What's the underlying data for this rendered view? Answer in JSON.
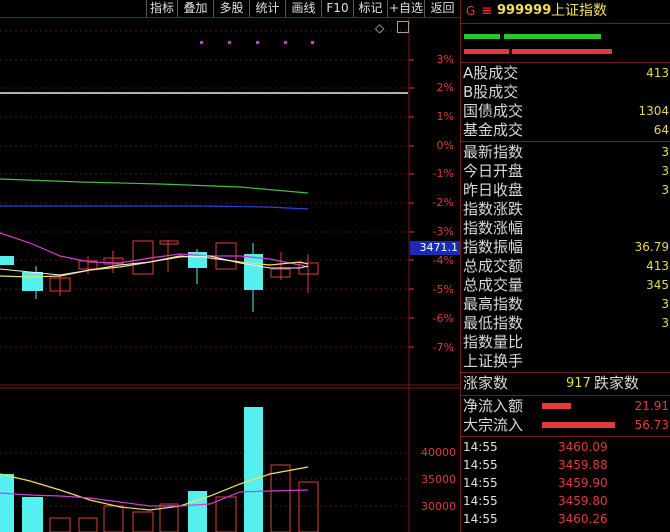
{
  "toolbar": {
    "buttons": [
      "指标",
      "叠加",
      "多股",
      "统计",
      "画线",
      "F10",
      "标记",
      "+自选",
      "返回"
    ]
  },
  "chart": {
    "pct_labels": [
      "3%",
      "2%",
      "1%",
      "0%",
      "-1%",
      "-2%",
      "-3%",
      "-4%",
      "-5%",
      "-6%",
      "-7%"
    ],
    "price_tag": "3471.1",
    "volume_labels": [
      "40000",
      "35000",
      "30000"
    ],
    "collapse_icon": "◇"
  },
  "panel": {
    "badge": "G",
    "menu_icon": "≡",
    "code": "999999",
    "name": "上证指数",
    "rows": [
      {
        "label": "A股成交",
        "value": "413"
      },
      {
        "label": "B股成交",
        "value": ""
      },
      {
        "label": "国债成交",
        "value": "1304"
      },
      {
        "label": "基金成交",
        "value": "64"
      },
      {
        "label": "最新指数",
        "value": "3"
      },
      {
        "label": "今日开盘",
        "value": "3"
      },
      {
        "label": "昨日收盘",
        "value": "3"
      },
      {
        "label": "指数涨跌",
        "value": ""
      },
      {
        "label": "指数涨幅",
        "value": ""
      },
      {
        "label": "指数振幅",
        "value": "36.79"
      },
      {
        "label": "总成交额",
        "value": "413"
      },
      {
        "label": "总成交量",
        "value": "345"
      },
      {
        "label": "最高指数",
        "value": "3"
      },
      {
        "label": "最低指数",
        "value": "3"
      },
      {
        "label": "指数量比",
        "value": ""
      },
      {
        "label": "上证换手",
        "value": ""
      }
    ],
    "rise_label": "涨家数",
    "rise_count": "917",
    "fall_label": "跌家数",
    "flows": [
      {
        "label": "净流入额",
        "value": "21.91"
      },
      {
        "label": "大宗流入",
        "value": "56.73"
      }
    ],
    "ticks": [
      {
        "time": "14:55",
        "price": "3460.09"
      },
      {
        "time": "14:55",
        "price": "3459.88"
      },
      {
        "time": "14:55",
        "price": "3459.90"
      },
      {
        "time": "14:55",
        "price": "3459.80"
      },
      {
        "time": "14:55",
        "price": "3460.26"
      }
    ]
  },
  "colors": {
    "up": "#e23b3b",
    "down": "#54f0f0",
    "ma_yellow": "#f0e060",
    "ma_magenta": "#d040d0",
    "ma_green": "#40c040",
    "ma_blue": "#3040e0",
    "value_yellow": "#e8d84a"
  }
}
